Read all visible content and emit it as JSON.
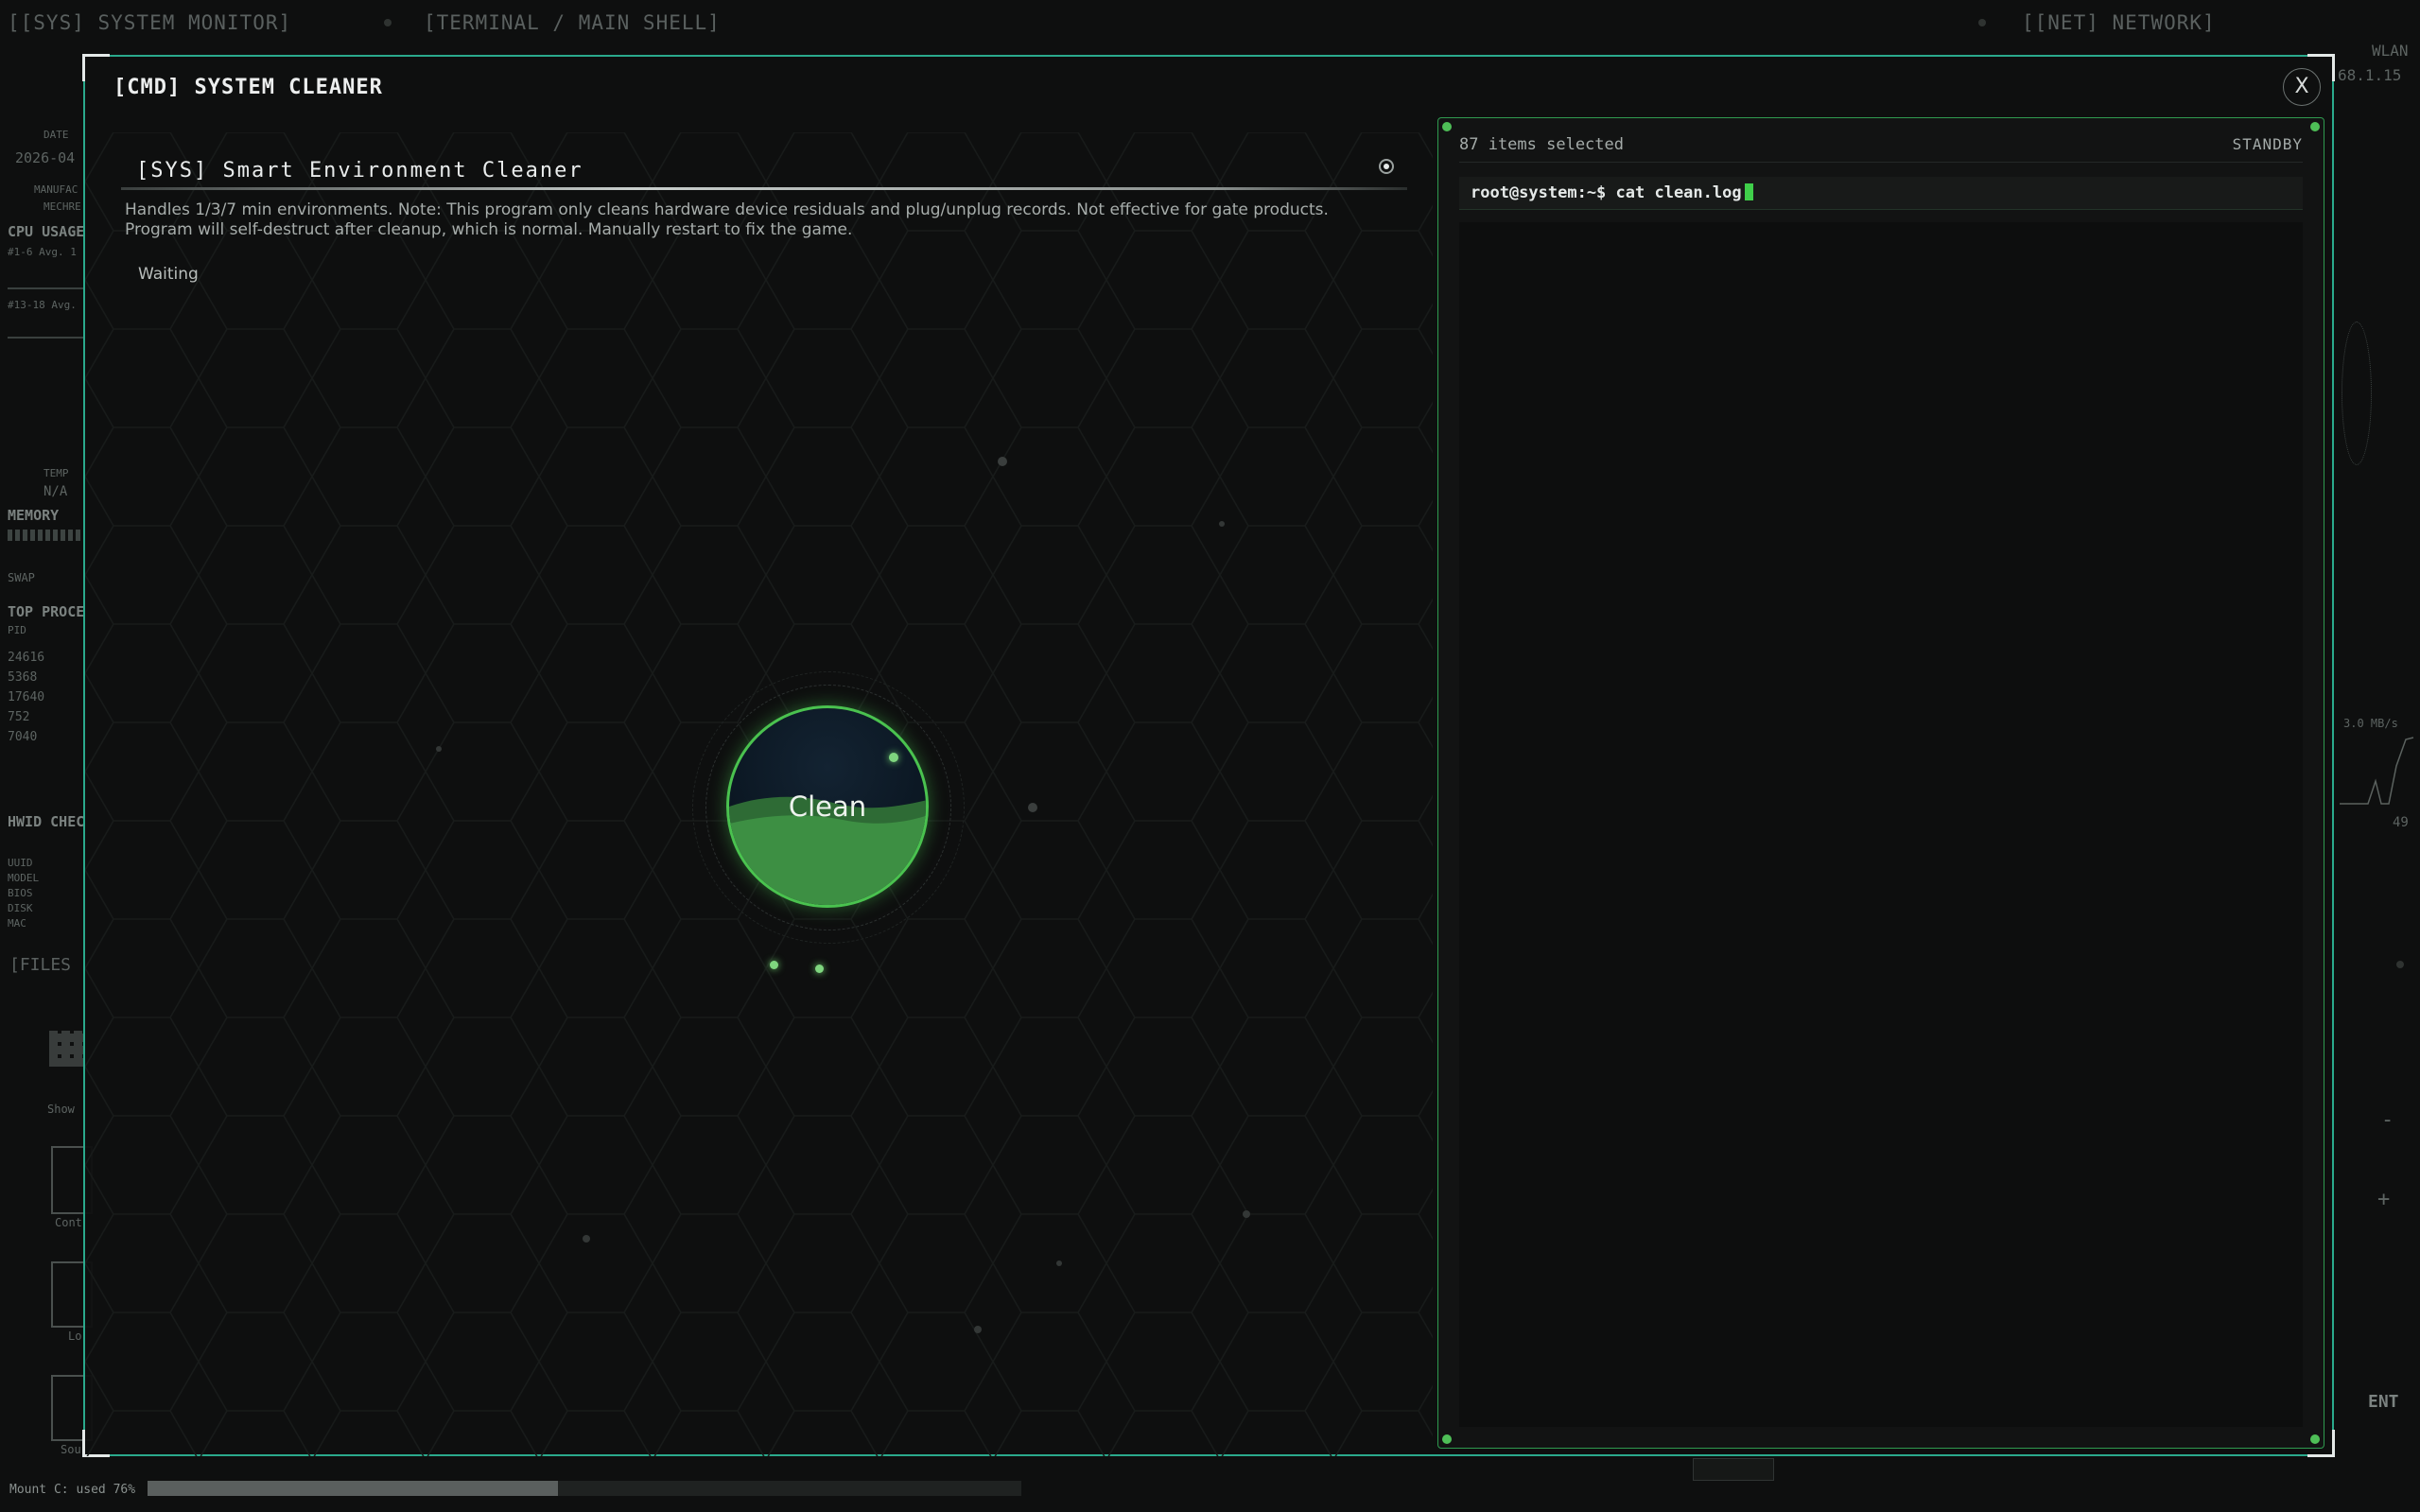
{
  "background": {
    "panels": [
      {
        "title": "[[SYS] SYSTEM MONITOR]"
      },
      {
        "title": "[TERMINAL / MAIN SHELL]"
      },
      {
        "title": "[[NET] NETWORK]"
      }
    ],
    "sys_labels": {
      "date": "DATE",
      "date_value": "2026-04",
      "manufacturer": "MANUFAC",
      "mech": "MECHRE",
      "cpu_usage": "CPU USAGE",
      "cpu_group1": "#1-6  Avg. 1",
      "cpu_group2": "#13-18  Avg.",
      "temp": "TEMP",
      "temp_value": "N/A",
      "memory": "MEMORY",
      "swap": "SWAP",
      "top_processes": "TOP PROCE",
      "pid_header": "PID",
      "pids": [
        "24616",
        "5368",
        "17640",
        "752",
        "7040"
      ],
      "hwid": "HWID CHEC",
      "hwid_rows": [
        "UUID",
        "MODEL",
        "BIOS",
        "DISK",
        "MAC"
      ],
      "filesystem": "[FILES",
      "show": "Show",
      "folder1": "Cont",
      "folder2": "Lo",
      "folder3": "Sou"
    },
    "net_labels": {
      "wlan": "WLAN",
      "ip": "68.1.15",
      "rate1": "3.0 MB/s",
      "rate_value": "49",
      "minus": "-",
      "plus": "+",
      "ent": "ENT"
    },
    "mount": {
      "label": "Mount C: used 76%",
      "used_fraction": 0.47
    }
  },
  "modal": {
    "title": "[CMD] SYSTEM CLEANER",
    "close_label": "X",
    "cleaner": {
      "title": "[SYS] Smart Environment Cleaner",
      "description": "Handles 1/3/7 min environments. Note: This program only cleans hardware device residuals and plug/unplug records. Not effective for gate products. Program will self-destruct after cleanup, which is normal. Manually restart to fix the game.",
      "status": "Waiting",
      "button_label": "Clean"
    },
    "terminal": {
      "selected": "87 items selected",
      "status": "STANDBY",
      "prompt": "root@system:~$ ",
      "command": "cat clean.log"
    }
  },
  "colors": {
    "accent": "#2aa98c",
    "green": "#4ac24f",
    "bg": "#0e0f0f"
  }
}
